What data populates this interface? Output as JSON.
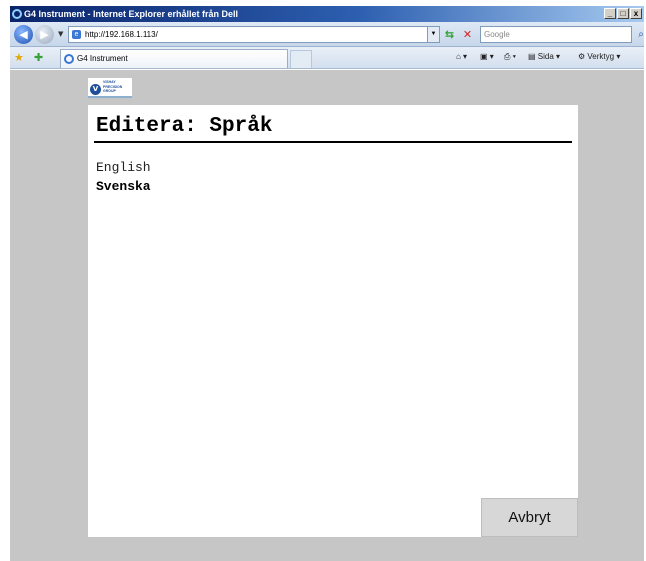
{
  "window": {
    "title": "G4 Instrument - Internet Explorer erhållet från Dell",
    "controls": [
      "_",
      "□",
      "x"
    ]
  },
  "address_bar": {
    "url": "http://192.168.1.113/",
    "search_placeholder": "Google"
  },
  "tab_bar": {
    "tab_title": "G4 Instrument",
    "commands": {
      "page": "Sida",
      "tools": "Verktyg"
    }
  },
  "page": {
    "title": "Editera: Språk",
    "languages": [
      {
        "label": "English",
        "selected": false
      },
      {
        "label": "Svenska",
        "selected": true
      }
    ],
    "cancel_label": "Avbryt"
  },
  "logo": {
    "lines": [
      "VISHAY",
      "PRECISION",
      "GROUP"
    ]
  },
  "colors": {
    "title_bar": "#0a246a",
    "background": "#c6c6c6",
    "panel": "#ffffff",
    "button": "#d7d7d7"
  }
}
